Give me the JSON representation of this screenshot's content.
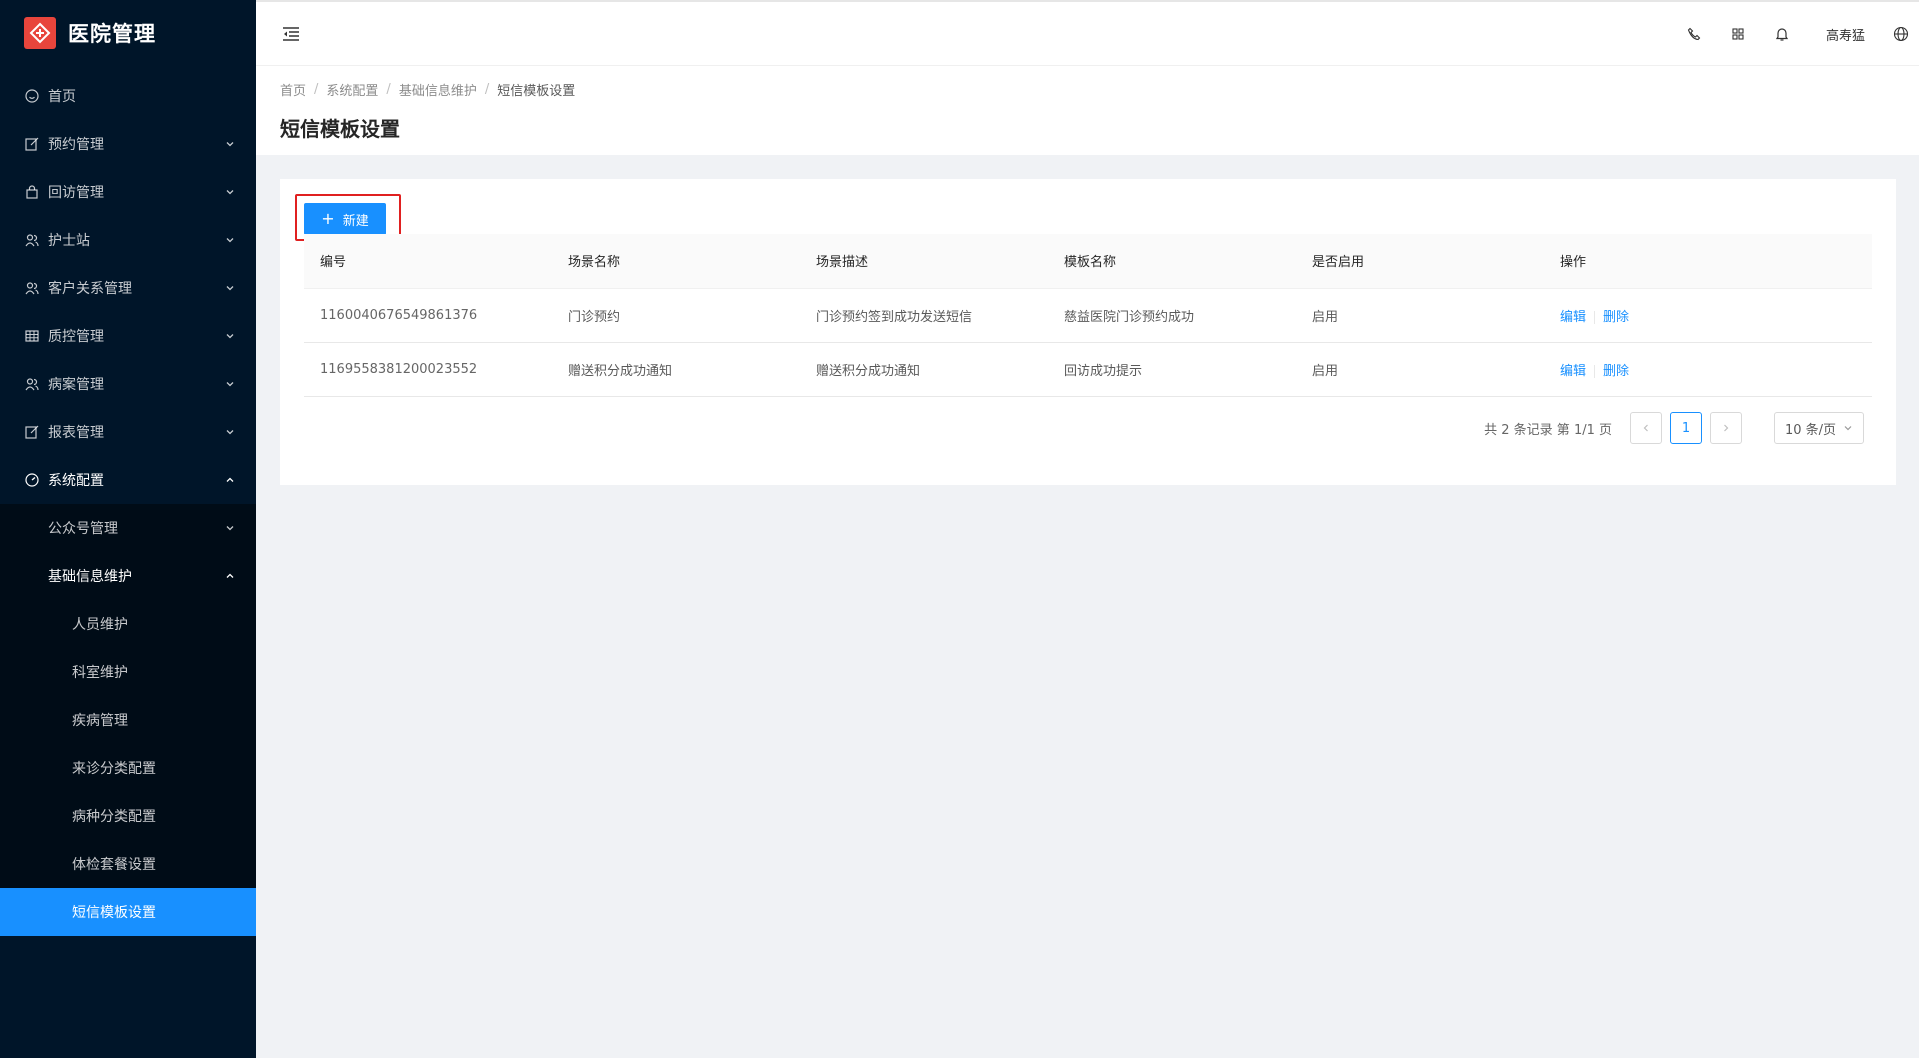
{
  "app": {
    "title": "医院管理"
  },
  "sidebar": {
    "items": [
      {
        "label": "首页",
        "icon": "smile-icon"
      },
      {
        "label": "预约管理",
        "icon": "form-icon"
      },
      {
        "label": "回访管理",
        "icon": "lock-box-icon"
      },
      {
        "label": "护士站",
        "icon": "users-icon"
      },
      {
        "label": "客户关系管理",
        "icon": "users-icon"
      },
      {
        "label": "质控管理",
        "icon": "table-icon"
      },
      {
        "label": "病案管理",
        "icon": "users-icon"
      },
      {
        "label": "报表管理",
        "icon": "form-icon"
      },
      {
        "label": "系统配置",
        "icon": "dashboard-icon"
      }
    ],
    "system_sub": [
      {
        "label": "公众号管理"
      },
      {
        "label": "基础信息维护"
      }
    ],
    "basic_sub": [
      {
        "label": "人员维护"
      },
      {
        "label": "科室维护"
      },
      {
        "label": "疾病管理"
      },
      {
        "label": "来诊分类配置"
      },
      {
        "label": "病种分类配置"
      },
      {
        "label": "体检套餐设置"
      },
      {
        "label": "短信模板设置"
      }
    ]
  },
  "header": {
    "username": "高寿猛",
    "icons": [
      "phone-icon",
      "apps-icon",
      "bell-icon",
      "globe-icon"
    ]
  },
  "breadcrumb": [
    "首页",
    "系统配置",
    "基础信息维护",
    "短信模板设置"
  ],
  "page": {
    "title": "短信模板设置"
  },
  "toolbar": {
    "new_label": "新建"
  },
  "table": {
    "columns": [
      "编号",
      "场景名称",
      "场景描述",
      "模板名称",
      "是否启用",
      "操作"
    ],
    "rows": [
      {
        "id": "1160040676549861376",
        "scene": "门诊预约",
        "desc": "门诊预约签到成功发送短信",
        "template": "慈益医院门诊预约成功",
        "enabled": "启用",
        "edit": "编辑",
        "delete": "删除"
      },
      {
        "id": "1169558381200023552",
        "scene": "赠送积分成功通知",
        "desc": "赠送积分成功通知",
        "template": "回访成功提示",
        "enabled": "启用",
        "edit": "编辑",
        "delete": "删除"
      }
    ]
  },
  "pagination": {
    "total_text": "共 2 条记录 第 1/1 页",
    "current": "1",
    "page_size": "10 条/页"
  },
  "colors": {
    "primary": "#1890ff",
    "sidebar_bg": "#001529",
    "highlight_border": "#e02020",
    "logo": "#e8453c"
  }
}
